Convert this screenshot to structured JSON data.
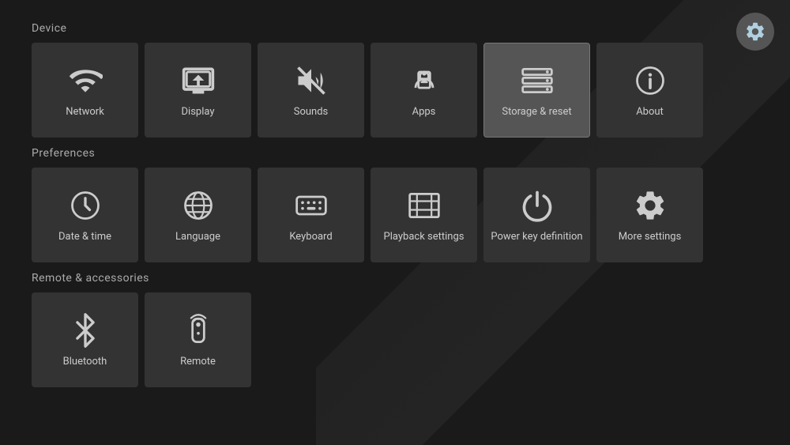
{
  "gear": {
    "label": "Settings gear"
  },
  "sections": [
    {
      "id": "device",
      "label": "Device",
      "tiles": [
        {
          "id": "network",
          "label": "Network",
          "icon": "wifi"
        },
        {
          "id": "display",
          "label": "Display",
          "icon": "display"
        },
        {
          "id": "sounds",
          "label": "Sounds",
          "icon": "sounds"
        },
        {
          "id": "apps",
          "label": "Apps",
          "icon": "apps"
        },
        {
          "id": "storage-reset",
          "label": "Storage & reset",
          "icon": "storage",
          "active": true
        },
        {
          "id": "about",
          "label": "About",
          "icon": "about"
        }
      ]
    },
    {
      "id": "preferences",
      "label": "Preferences",
      "tiles": [
        {
          "id": "date-time",
          "label": "Date & time",
          "icon": "clock"
        },
        {
          "id": "language",
          "label": "Language",
          "icon": "globe"
        },
        {
          "id": "keyboard",
          "label": "Keyboard",
          "icon": "keyboard"
        },
        {
          "id": "playback",
          "label": "Playback settings",
          "icon": "playback"
        },
        {
          "id": "power-key",
          "label": "Power key definition",
          "icon": "power"
        },
        {
          "id": "more-settings",
          "label": "More settings",
          "icon": "gear"
        }
      ]
    },
    {
      "id": "remote",
      "label": "Remote & accessories",
      "tiles": [
        {
          "id": "bluetooth",
          "label": "Bluetooth",
          "icon": "bluetooth"
        },
        {
          "id": "remote",
          "label": "Remote",
          "icon": "remote"
        }
      ]
    }
  ]
}
